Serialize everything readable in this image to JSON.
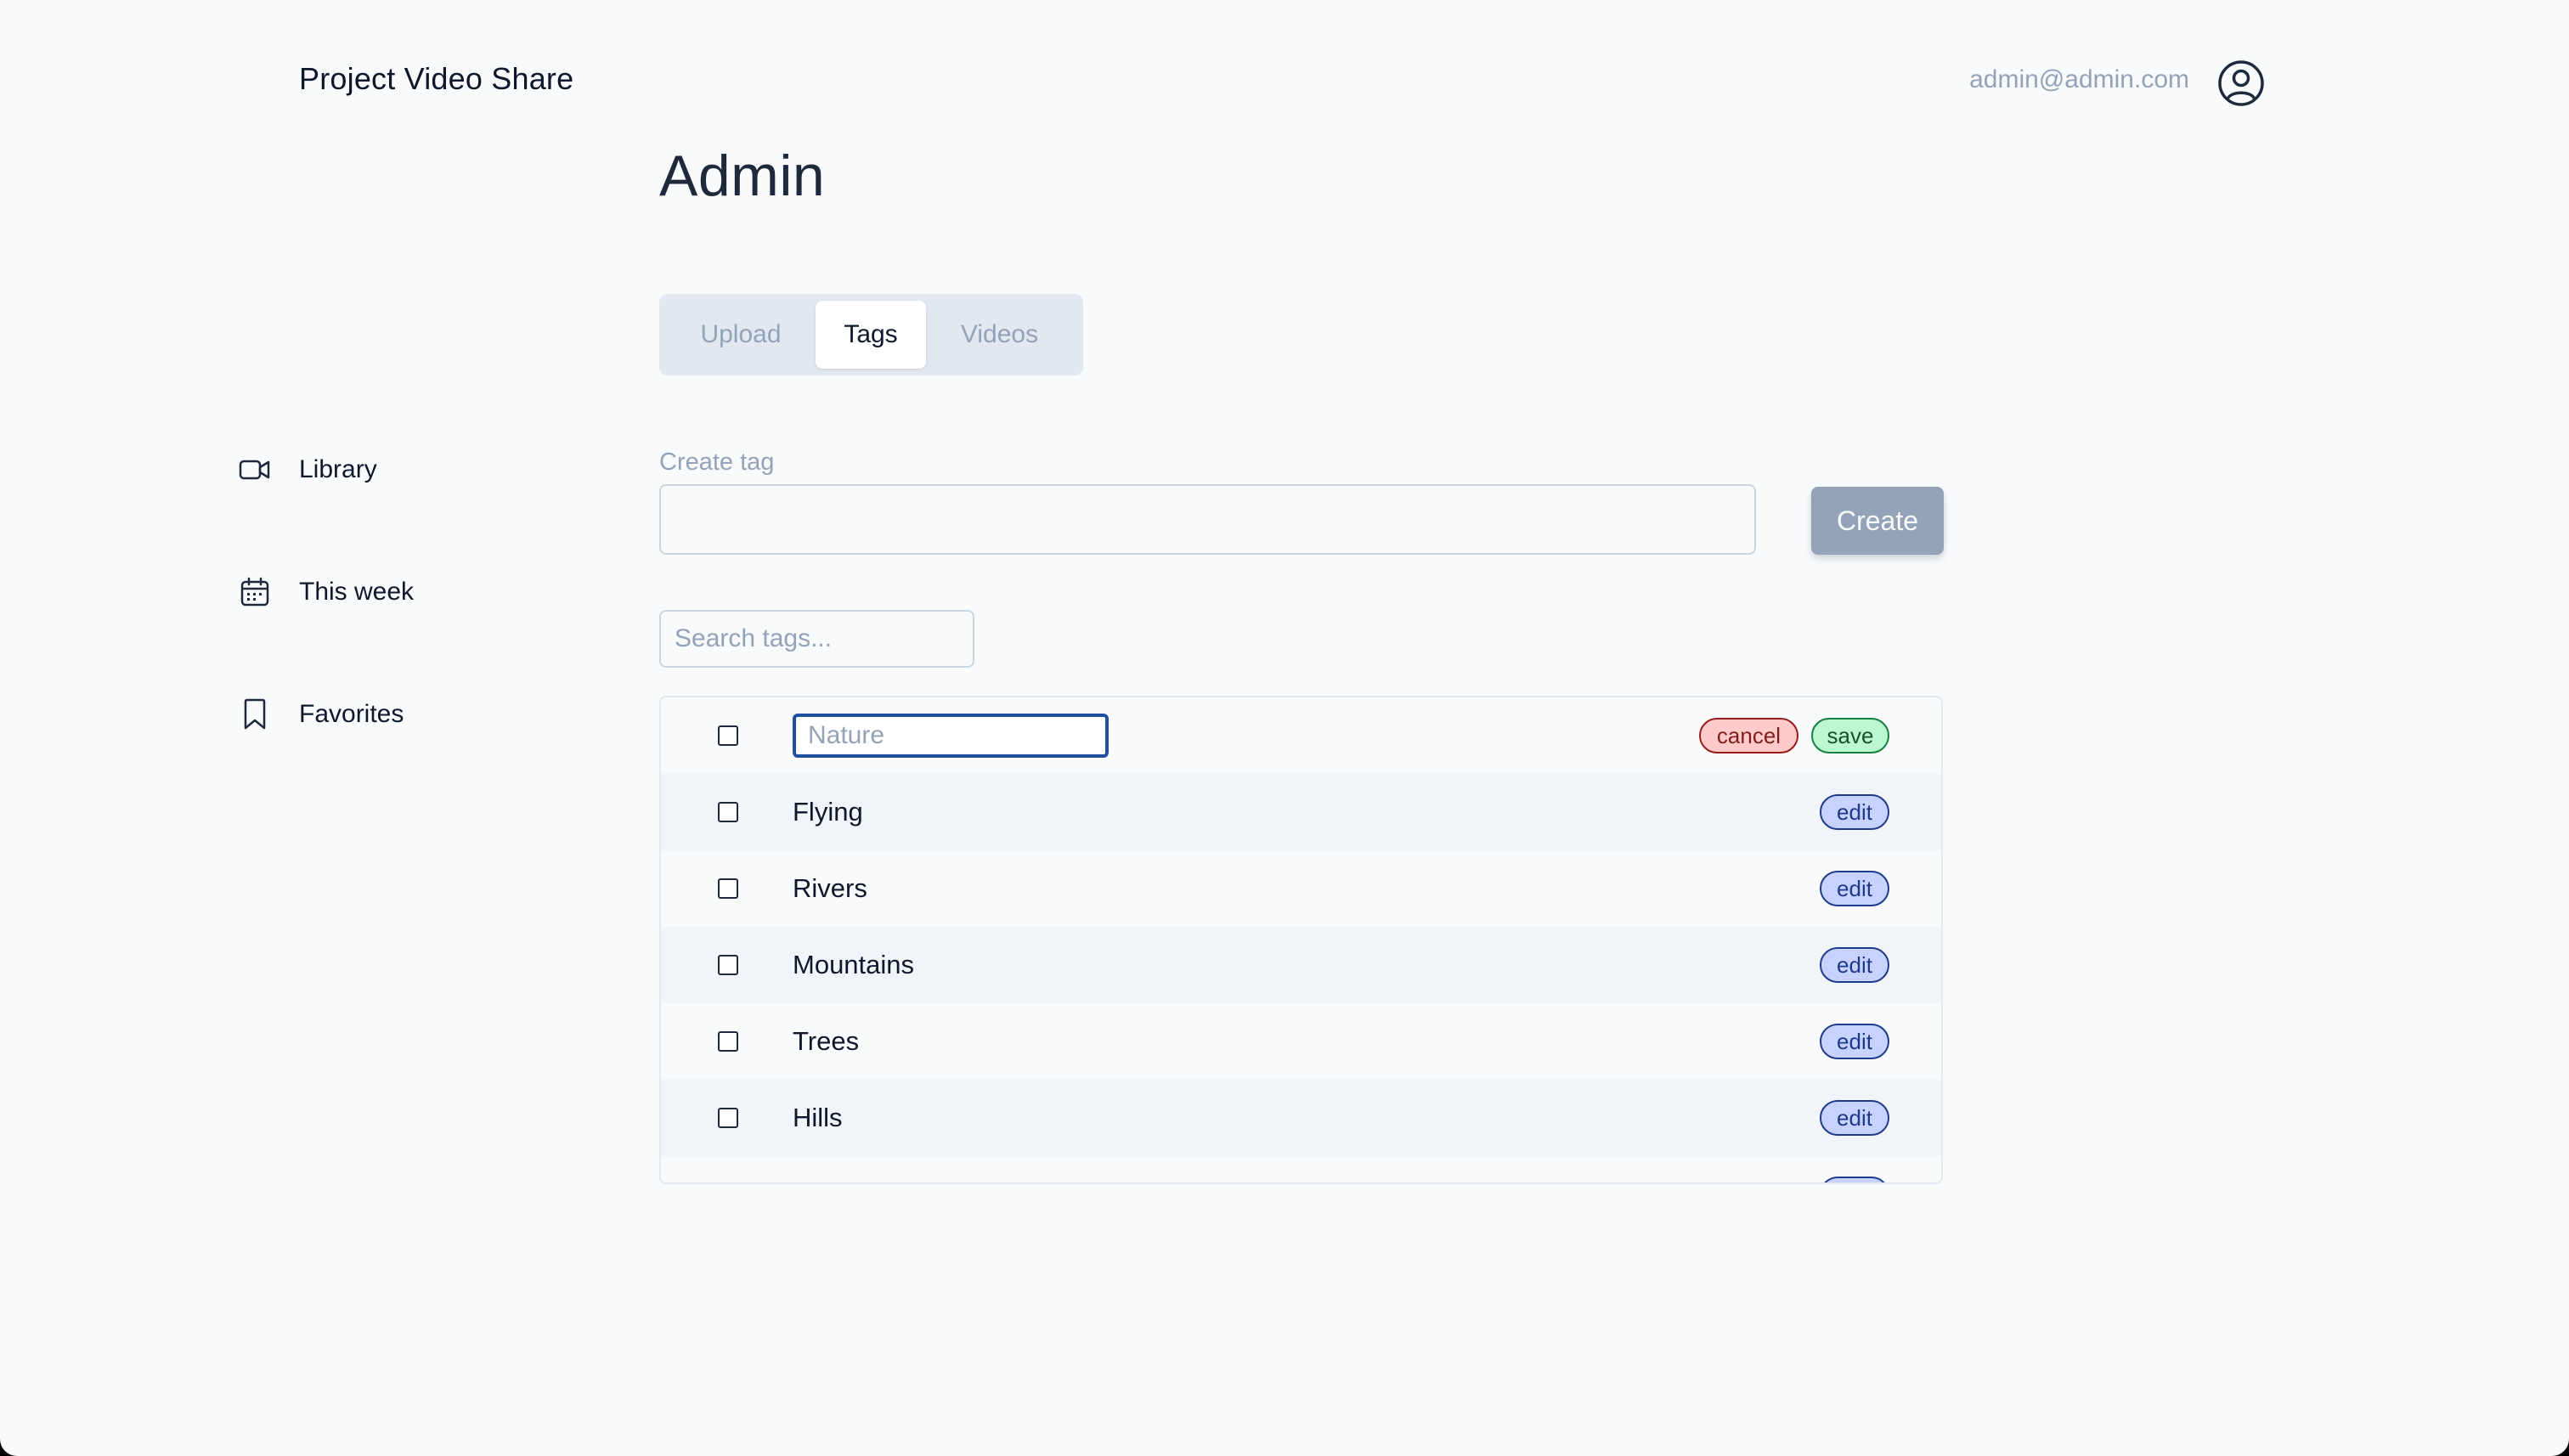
{
  "header": {
    "brand": "Project Video Share",
    "user_email": "admin@admin.com",
    "avatar_icon": "user-circle-icon"
  },
  "page": {
    "title": "Admin"
  },
  "tabs": [
    {
      "label": "Upload",
      "active": false
    },
    {
      "label": "Tags",
      "active": true
    },
    {
      "label": "Videos",
      "active": false
    }
  ],
  "sidebar": {
    "items": [
      {
        "label": "Library",
        "icon": "video-camera-icon"
      },
      {
        "label": "This week",
        "icon": "calendar-icon"
      },
      {
        "label": "Favorites",
        "icon": "bookmark-icon"
      }
    ]
  },
  "create_tag": {
    "label": "Create tag",
    "value": "",
    "button_label": "Create"
  },
  "search": {
    "placeholder": "Search tags...",
    "value": ""
  },
  "tag_list": {
    "editing_row": {
      "placeholder": "Nature",
      "value": "",
      "cancel_label": "cancel",
      "save_label": "save"
    },
    "rows": [
      {
        "name": "Flying",
        "action_label": "edit"
      },
      {
        "name": "Rivers",
        "action_label": "edit"
      },
      {
        "name": "Mountains",
        "action_label": "edit"
      },
      {
        "name": "Trees",
        "action_label": "edit"
      },
      {
        "name": "Hills",
        "action_label": "edit"
      }
    ]
  },
  "colors": {
    "background": "#f8fafc",
    "muted_text": "#94a3b8",
    "edit_pill": "#c7d2fe",
    "cancel_pill": "#fecaca",
    "save_pill": "#bbf7d0",
    "create_button": "#94a3b8",
    "focus_border": "#1e4fa1"
  }
}
